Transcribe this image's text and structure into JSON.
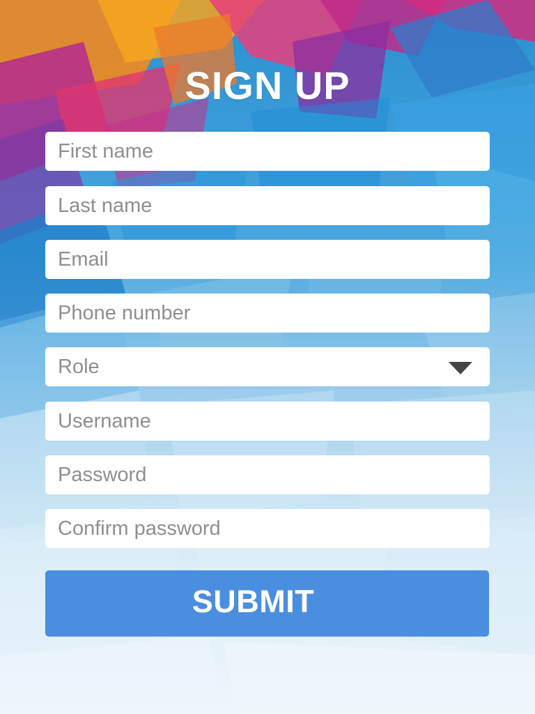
{
  "page": {
    "title": "SIGN UP"
  },
  "form": {
    "first_name": {
      "placeholder": "First name",
      "value": ""
    },
    "last_name": {
      "placeholder": "Last name",
      "value": ""
    },
    "email": {
      "placeholder": "Email",
      "value": ""
    },
    "phone": {
      "placeholder": "Phone number",
      "value": ""
    },
    "role": {
      "selected": "Role"
    },
    "username": {
      "placeholder": "Username",
      "value": ""
    },
    "password": {
      "placeholder": "Password",
      "value": ""
    },
    "confirm_password": {
      "placeholder": "Confirm password",
      "value": ""
    },
    "submit_label": "SUBMIT"
  },
  "icons": {
    "role_dropdown": "chevron-down-icon"
  },
  "colors": {
    "accent": "#4a8ee0",
    "title": "#ffffff",
    "field_background": "#ffffff",
    "placeholder_text": "#8e8e8e",
    "chevron": "#444444"
  }
}
